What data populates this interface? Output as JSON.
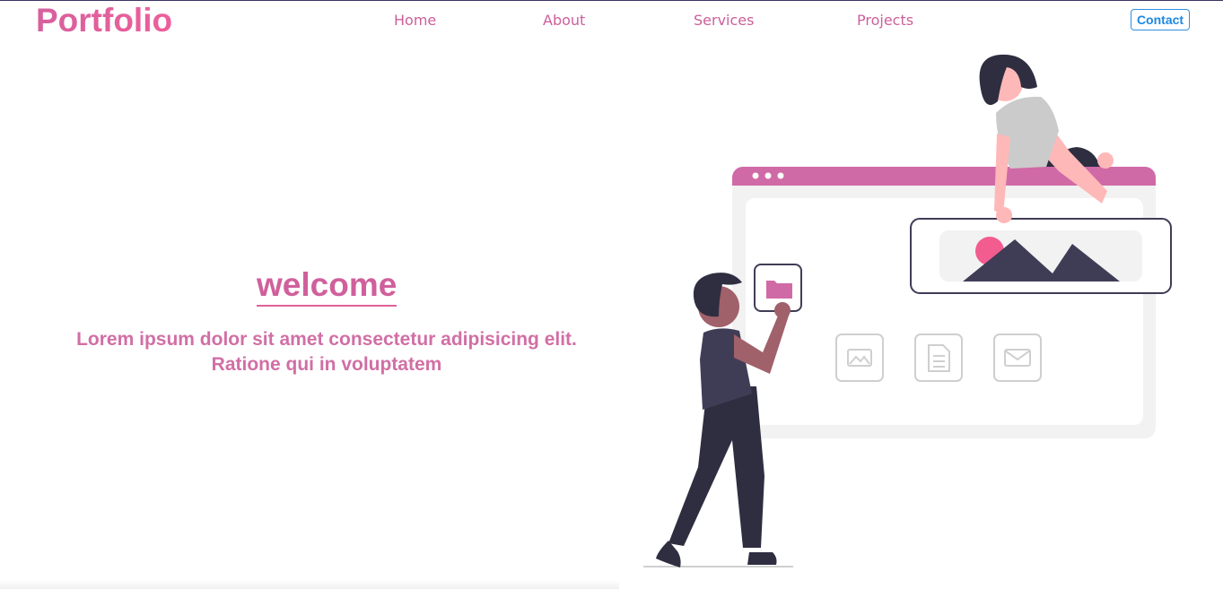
{
  "header": {
    "logo": "Portfolio",
    "nav": [
      {
        "label": "Home"
      },
      {
        "label": "About"
      },
      {
        "label": "Services"
      },
      {
        "label": "Projects"
      }
    ],
    "contact_label": "Contact"
  },
  "hero": {
    "title": "welcome",
    "text": "Lorem ipsum dolor sit amet consectetur adipisicing elit. Ratione qui in voluptatem"
  },
  "colors": {
    "accent": "#d0609c",
    "contact": "#1e88e0",
    "dark": "#2f2e41",
    "browser_bar": "#d06aa6"
  }
}
